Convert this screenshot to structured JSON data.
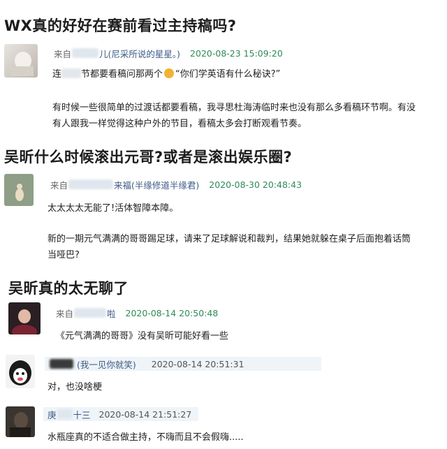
{
  "posts": [
    {
      "heading": "WX真的好好在赛前看过主持稿吗?",
      "comments": [
        {
          "from_prefix": "来自",
          "user_suffix": "儿",
          "user_extra": "(尼采所说的星星。)",
          "date": "2020-08-23 15:09:20",
          "line1_a": "连",
          "line1_b": "节都要看稿问那两个",
          "line1_c": "“你们学英语有什么秘诀?”",
          "para_line1": "有时候一些很简单的过渡话都要看稿，我寻思杜海涛临时来也没有那么多看稿环节啊。有没",
          "para_line2": "有人跟我一样觉得这种户外的节目，看稿太多会打断观看节奏。"
        }
      ]
    },
    {
      "heading": "吴昕什么时候滚出元哥?或者是滚出娱乐圈?",
      "comments": [
        {
          "from_prefix": "来自",
          "user_suffix": "来福",
          "user_extra": "(半缘修道半缘君)",
          "date": "2020-08-30 20:48:43",
          "line1": "太太太太无能了!活体智障本障。",
          "para_line1": "新的一期元气满满的哥哥踢足球，请来了足球解说和裁判，结果她就躲在桌子后面抱着话筒",
          "para_line2": "当哑巴?"
        }
      ]
    },
    {
      "heading": "吴昕真的太无聊了",
      "comments": [
        {
          "from_prefix": "来自",
          "user_suffix": "啦",
          "date": "2020-08-14 20:50:48",
          "text": "《元气满满的哥哥》没有吴昕可能好看一些"
        },
        {
          "user_extra": "(我一见你就笑)",
          "date": "2020-08-14 20:51:31",
          "text": "对，也没啥梗"
        },
        {
          "user_prefix": "庚",
          "user_suffix": "十三",
          "date": "2020-08-14 21:51:27",
          "text": "水瓶座真的不适合做主持，不嗨而且不会假嗨....."
        }
      ]
    }
  ]
}
